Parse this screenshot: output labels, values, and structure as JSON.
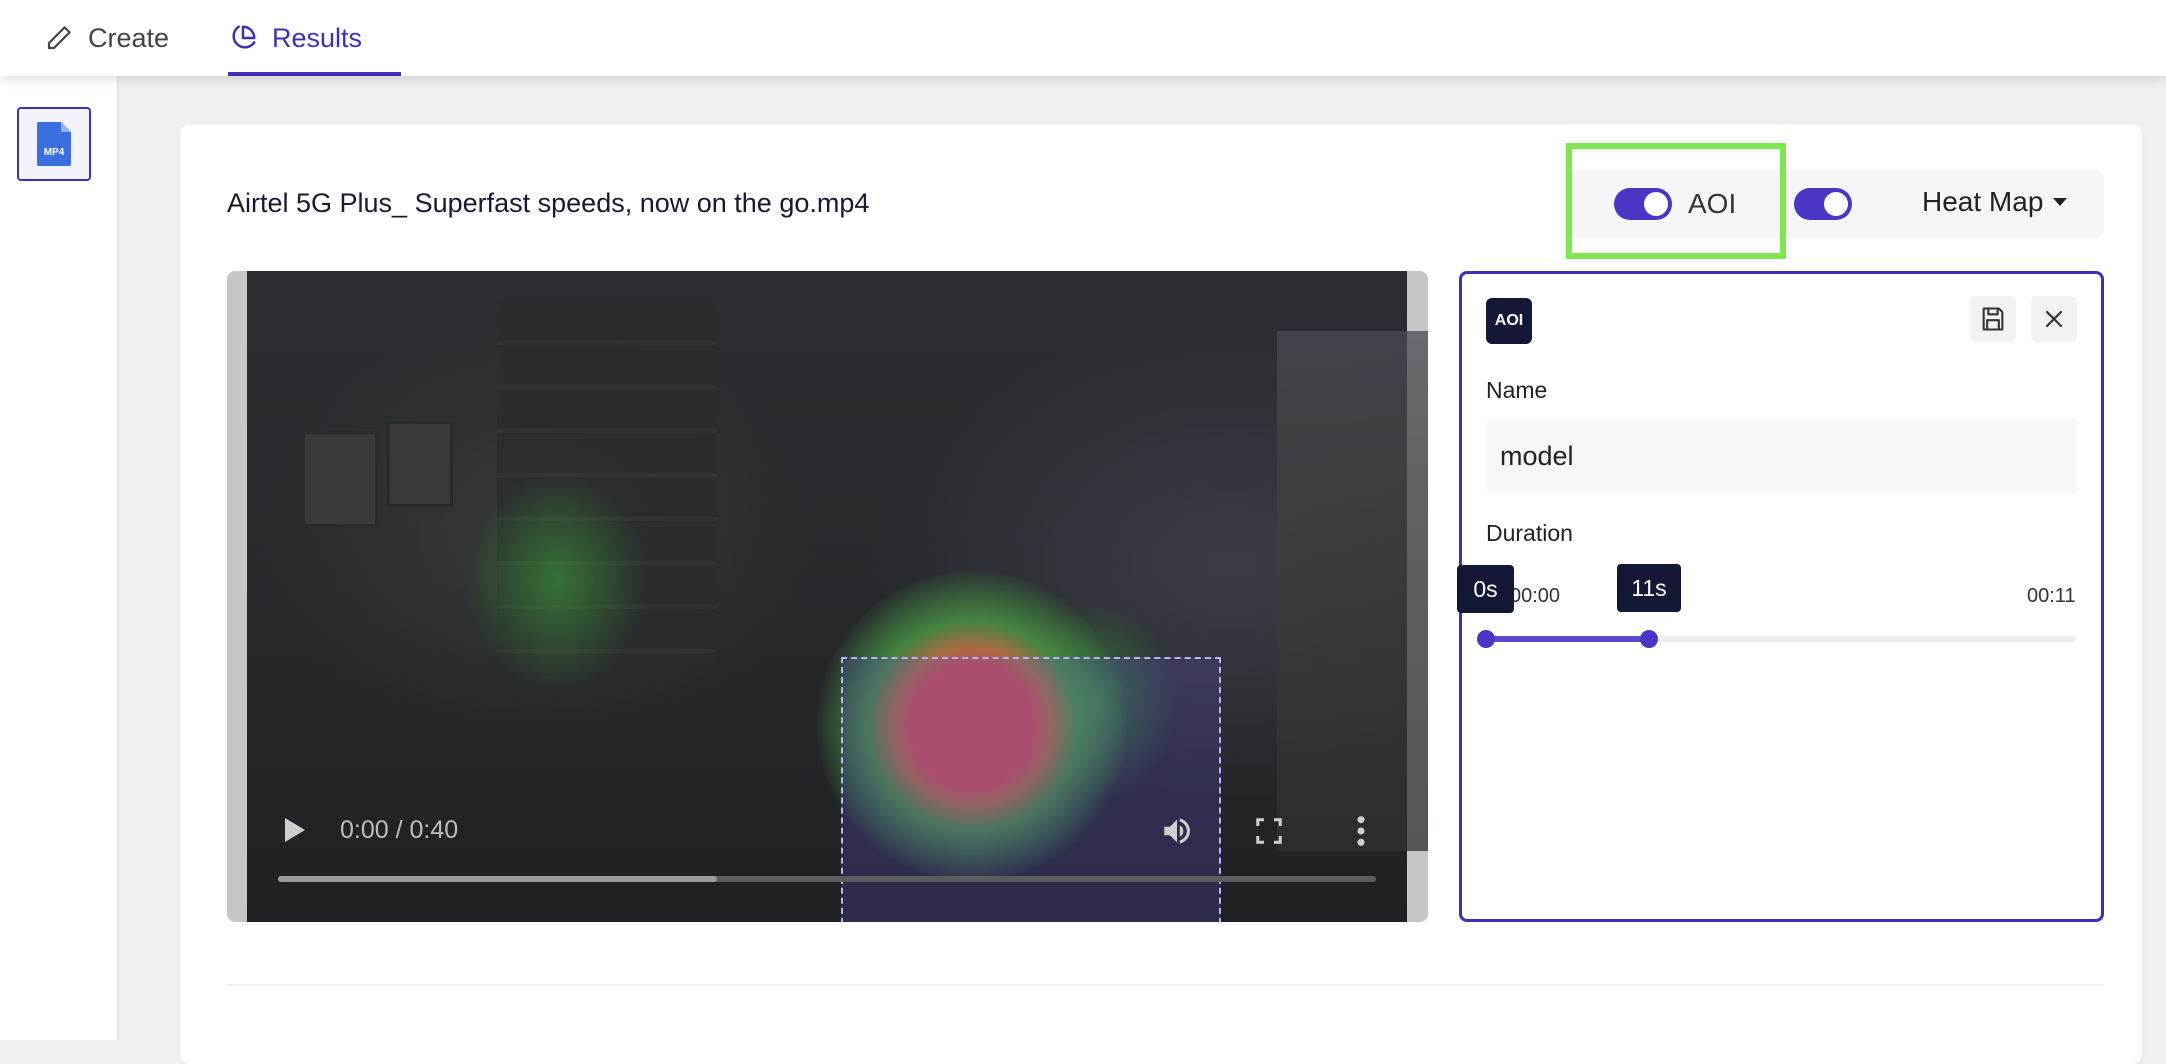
{
  "tabs": {
    "create_label": "Create",
    "results_label": "Results"
  },
  "sidebar": {
    "file_badge": "MP4"
  },
  "video": {
    "title": "Airtel 5G Plus_ Superfast speeds, now on the go.mp4",
    "time": "0:00 / 0:40",
    "progress_fraction": 0.4
  },
  "controls": {
    "aoi_label": "AOI",
    "aoi_toggle_on": true,
    "heatmap_toggle_on": true,
    "view_select": "Heat Map"
  },
  "aoi_panel": {
    "badge": "AOI",
    "name_label": "Name",
    "name_value": "model",
    "duration_label": "Duration",
    "start_time": "00:00",
    "end_time": "00:11",
    "start_tip": "0s",
    "end_tip": "11s",
    "range_fraction": [
      0,
      0.275
    ]
  },
  "colors": {
    "accent": "#3f2fb5",
    "highlight": "#7ee650",
    "tooltip_bg": "#141735"
  }
}
